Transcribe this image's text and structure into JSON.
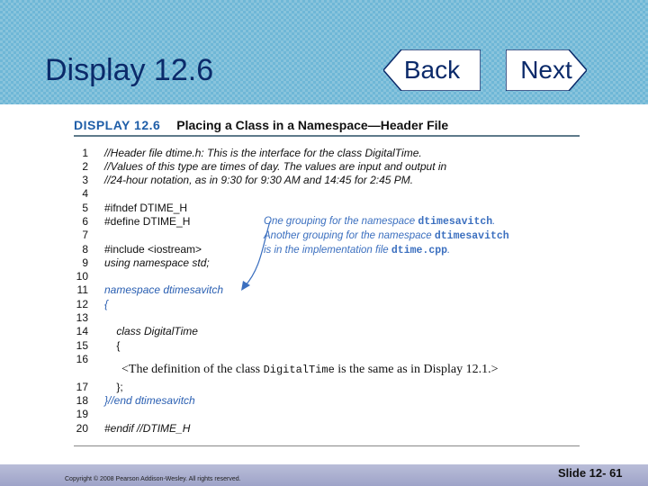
{
  "slide": {
    "title": "Display 12.6",
    "nav": {
      "back_label": "Back",
      "next_label": "Next"
    },
    "copyright": "Copyright © 2008 Pearson Addison-Wesley. All rights reserved.",
    "slide_number": "Slide 12- 61"
  },
  "display": {
    "label": "DISPLAY 12.6",
    "caption": "Placing a Class in a Namespace—Header File"
  },
  "code_lines": [
    {
      "n": "1",
      "text": "//Header file dtime.h: This is the interface for the class DigitalTime."
    },
    {
      "n": "2",
      "text": "//Values of this type are times of day. The values are input and output in"
    },
    {
      "n": "3",
      "text": "//24-hour notation, as in 9:30 for 9:30 AM and 14:45 for 2:45 PM."
    },
    {
      "n": "4",
      "text": ""
    },
    {
      "n": "5",
      "text": "#ifndef DTIME_H"
    },
    {
      "n": "6",
      "text": "#define DTIME_H"
    },
    {
      "n": "7",
      "text": ""
    },
    {
      "n": "8",
      "text": "#include <iostream>"
    },
    {
      "n": "9",
      "text": "using namespace std;"
    },
    {
      "n": "10",
      "text": ""
    },
    {
      "n": "11",
      "text": "namespace dtimesavitch"
    },
    {
      "n": "12",
      "text": "{"
    },
    {
      "n": "13",
      "text": ""
    },
    {
      "n": "14",
      "text": "    class DigitalTime"
    },
    {
      "n": "15",
      "text": "    {"
    },
    {
      "n": "16",
      "text": ""
    },
    {
      "n": "17",
      "text": "    };"
    },
    {
      "n": "18",
      "text": "}//end dtimesavitch"
    },
    {
      "n": "19",
      "text": ""
    },
    {
      "n": "20",
      "text": "#endif //DTIME_H"
    }
  ],
  "definition_note": {
    "before": "<The definition of the class ",
    "code": "DigitalTime",
    "after": " is the same as in Display 12.1.>"
  },
  "annotation": {
    "line1_text": "One grouping for the namespace ",
    "line1_code": "dtimesavitch",
    "line1_end": ".",
    "line2_text": "Another grouping for the namespace ",
    "line2_code": "dtimesavitch",
    "line3_text": "is in the implementation file ",
    "line3_code": "dtime.cpp",
    "line3_end": "."
  }
}
